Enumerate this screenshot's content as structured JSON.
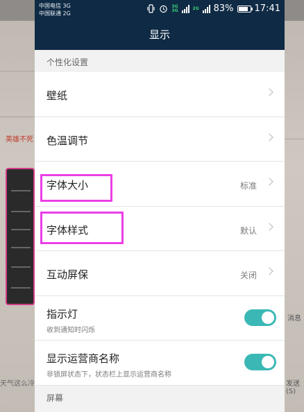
{
  "status_bar": {
    "carrier1": "中国电信 3G",
    "carrier2": "中国联通 2G",
    "net1": "3G",
    "net2": "2G",
    "battery": "83%",
    "battery_level": 0.83,
    "time": "17:41"
  },
  "header": {
    "title": "显示"
  },
  "sections": [
    {
      "title": "个性化设置",
      "items": [
        {
          "label": "壁纸"
        },
        {
          "label": "色温调节"
        },
        {
          "label": "字体大小",
          "value": "标准"
        },
        {
          "label": "字体样式",
          "value": "默认"
        },
        {
          "label": "互动屏保",
          "value": "关闭"
        },
        {
          "label": "指示灯",
          "sub": "收到通知时闪烁",
          "toggle_on": true
        },
        {
          "label": "显示运营商名称",
          "sub": "非锁屏状态下，状态栏上显示运营商名称",
          "toggle_on": true
        }
      ]
    },
    {
      "title": "屏幕"
    }
  ],
  "background": {
    "red_text": "英雄不死",
    "left_bottom_text": "天气这么冷",
    "right_mid_text": "消息",
    "right_bottom_text": "发送(S)"
  },
  "colors": {
    "header_bg": "#0f2a44",
    "toggle_on": "#3bb8b5",
    "highlight": "#ea3fe6"
  }
}
